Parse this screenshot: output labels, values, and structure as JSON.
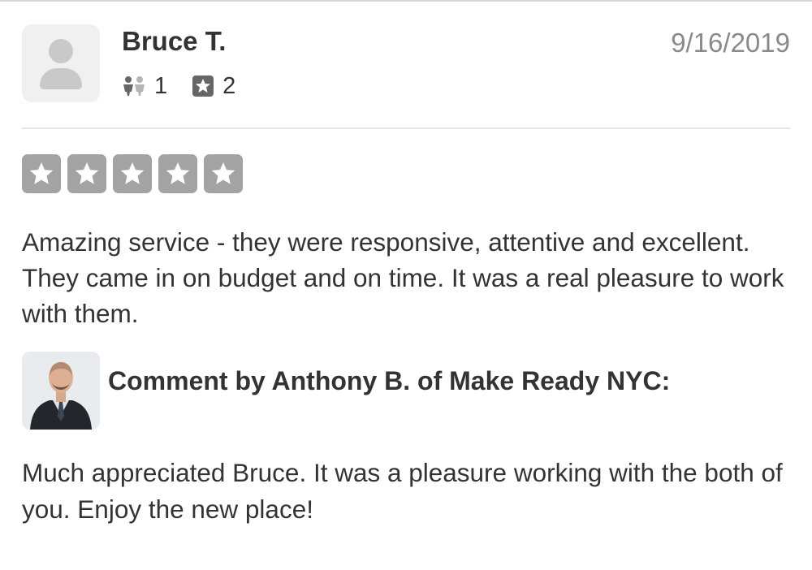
{
  "review": {
    "user": {
      "name": "Bruce T.",
      "avatar_icon": "default-user-avatar-icon",
      "friends_count": "1",
      "friends_icon": "friends-icon",
      "reviews_count": "2",
      "reviews_icon": "review-star-icon"
    },
    "date": "9/16/2019",
    "rating": {
      "value": 5,
      "max": 5,
      "star_color": "#a3a3a3"
    },
    "text": "Amazing service - they were responsive, attentive and excellent. They came in on budget and on time. It was a real pleasure to work with them."
  },
  "business_comment": {
    "header": "Comment by Anthony B. of Make Ready NYC:",
    "photo_icon": "business-owner-photo",
    "text": "Much appreciated Bruce. It was a pleasure working with the both of you. Enjoy the new place!"
  },
  "colors": {
    "text": "#333333",
    "muted": "#8a8a8a",
    "divider": "#e6e6e6"
  }
}
